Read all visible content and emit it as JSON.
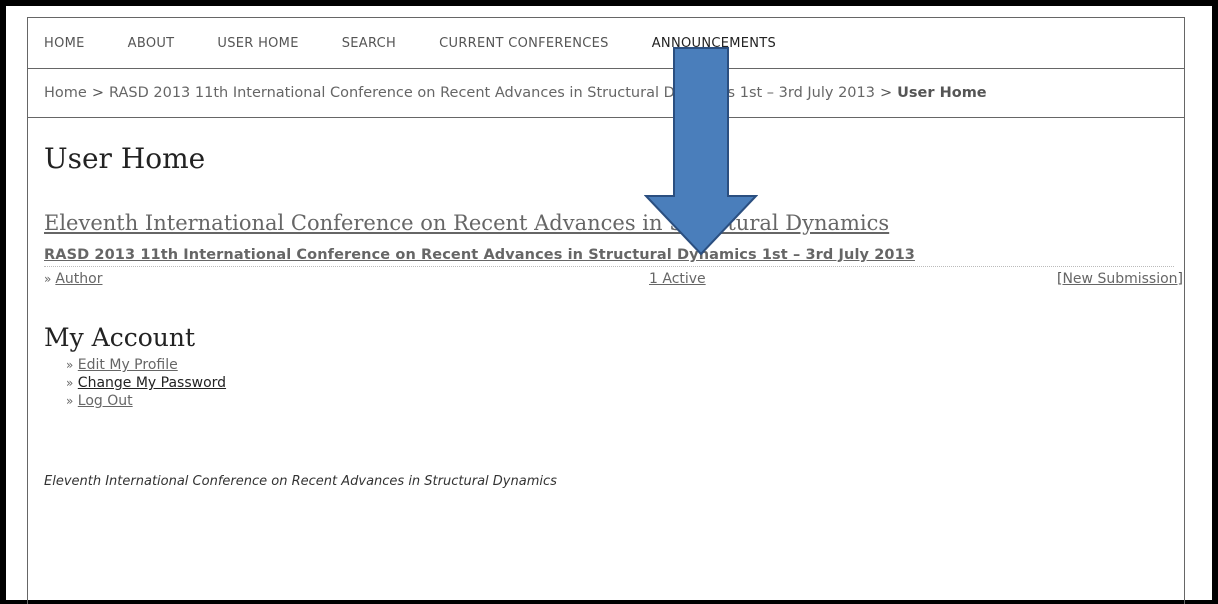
{
  "nav": {
    "items": [
      "HOME",
      "ABOUT",
      "USER HOME",
      "SEARCH",
      "CURRENT CONFERENCES",
      "ANNOUNCEMENTS"
    ]
  },
  "breadcrumb": {
    "home": "Home",
    "separator": ">",
    "conference": "RASD 2013 11th International Conference on Recent Advances in Structural Dynamics 1st – 3rd July 2013",
    "current": "User Home"
  },
  "main": {
    "title": "User Home",
    "journal_title": "Eleventh International Conference on Recent Advances in Structural Dynamics",
    "conference_title": "RASD 2013 11th International Conference on Recent Advances in Structural Dynamics 1st – 3rd July 2013",
    "role": {
      "prefix": "»",
      "label": "Author",
      "active": "1 Active",
      "new_submission": "New Submission"
    }
  },
  "account": {
    "title": "My Account",
    "items": [
      {
        "prefix": "»",
        "label": "Edit My Profile"
      },
      {
        "prefix": "»",
        "label": "Change My Password"
      },
      {
        "prefix": "»",
        "label": "Log Out"
      }
    ]
  },
  "footer": {
    "text": "Eleventh International Conference on Recent Advances in Structural Dynamics"
  },
  "colors": {
    "arrow_fill": "#4a7ebb",
    "arrow_stroke": "#2b4f80",
    "border": "#000000"
  }
}
